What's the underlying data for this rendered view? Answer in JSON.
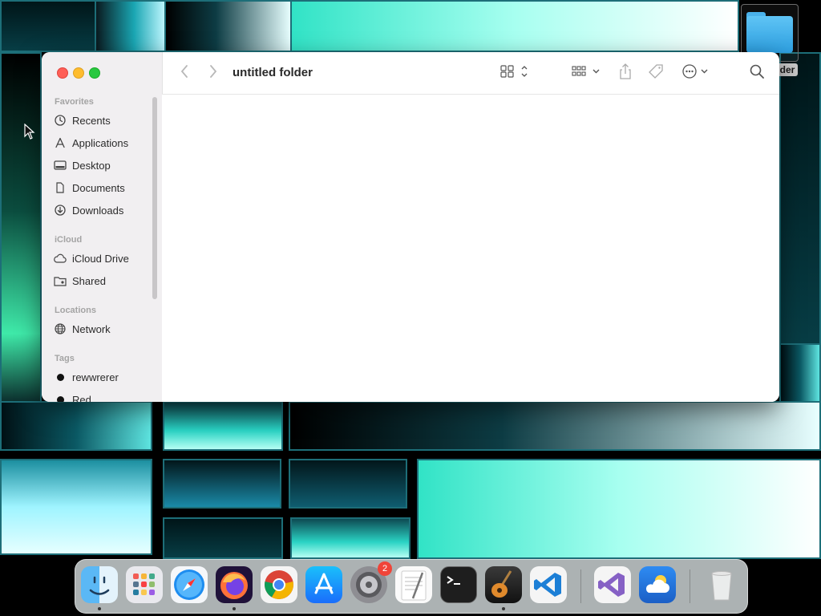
{
  "desktop": {
    "folder_label": "older"
  },
  "window": {
    "title": "untitled folder",
    "toolbar": {
      "back_icon": "chevron-left-icon",
      "forward_icon": "chevron-right-icon",
      "view_icon": "grid-view-icon",
      "group_icon": "group-by-icon",
      "share_icon": "share-icon",
      "tag_icon": "tag-icon",
      "more_icon": "ellipsis-circle-icon",
      "search_icon": "search-icon"
    }
  },
  "sidebar": {
    "favorites_header": "Favorites",
    "favorites": [
      {
        "label": "Recents",
        "icon": "clock-icon"
      },
      {
        "label": "Applications",
        "icon": "applications-icon"
      },
      {
        "label": "Desktop",
        "icon": "desktop-icon"
      },
      {
        "label": "Documents",
        "icon": "document-icon"
      },
      {
        "label": "Downloads",
        "icon": "download-icon"
      }
    ],
    "icloud_header": "iCloud",
    "icloud": [
      {
        "label": "iCloud Drive",
        "icon": "cloud-icon"
      },
      {
        "label": "Shared",
        "icon": "shared-folder-icon"
      }
    ],
    "locations_header": "Locations",
    "locations": [
      {
        "label": "Network",
        "icon": "globe-icon"
      }
    ],
    "tags_header": "Tags",
    "tags": [
      {
        "label": "rewwrerer",
        "color": "#111111"
      },
      {
        "label": "Red",
        "color": "#111111"
      }
    ]
  },
  "dock": {
    "apps": [
      {
        "name": "Finder",
        "running": true
      },
      {
        "name": "Launchpad",
        "running": false
      },
      {
        "name": "Safari",
        "running": false
      },
      {
        "name": "Firefox",
        "running": true
      },
      {
        "name": "Chrome",
        "running": false
      },
      {
        "name": "App Store",
        "running": false
      },
      {
        "name": "System Settings",
        "running": false,
        "badge": "2"
      },
      {
        "name": "TextEdit",
        "running": false
      },
      {
        "name": "Terminal",
        "running": false
      },
      {
        "name": "GarageBand",
        "running": true
      },
      {
        "name": "Visual Studio Code",
        "running": false
      },
      {
        "name": "Visual Studio",
        "running": false
      },
      {
        "name": "Weather",
        "running": false
      },
      {
        "name": "Trash",
        "running": false
      }
    ]
  }
}
